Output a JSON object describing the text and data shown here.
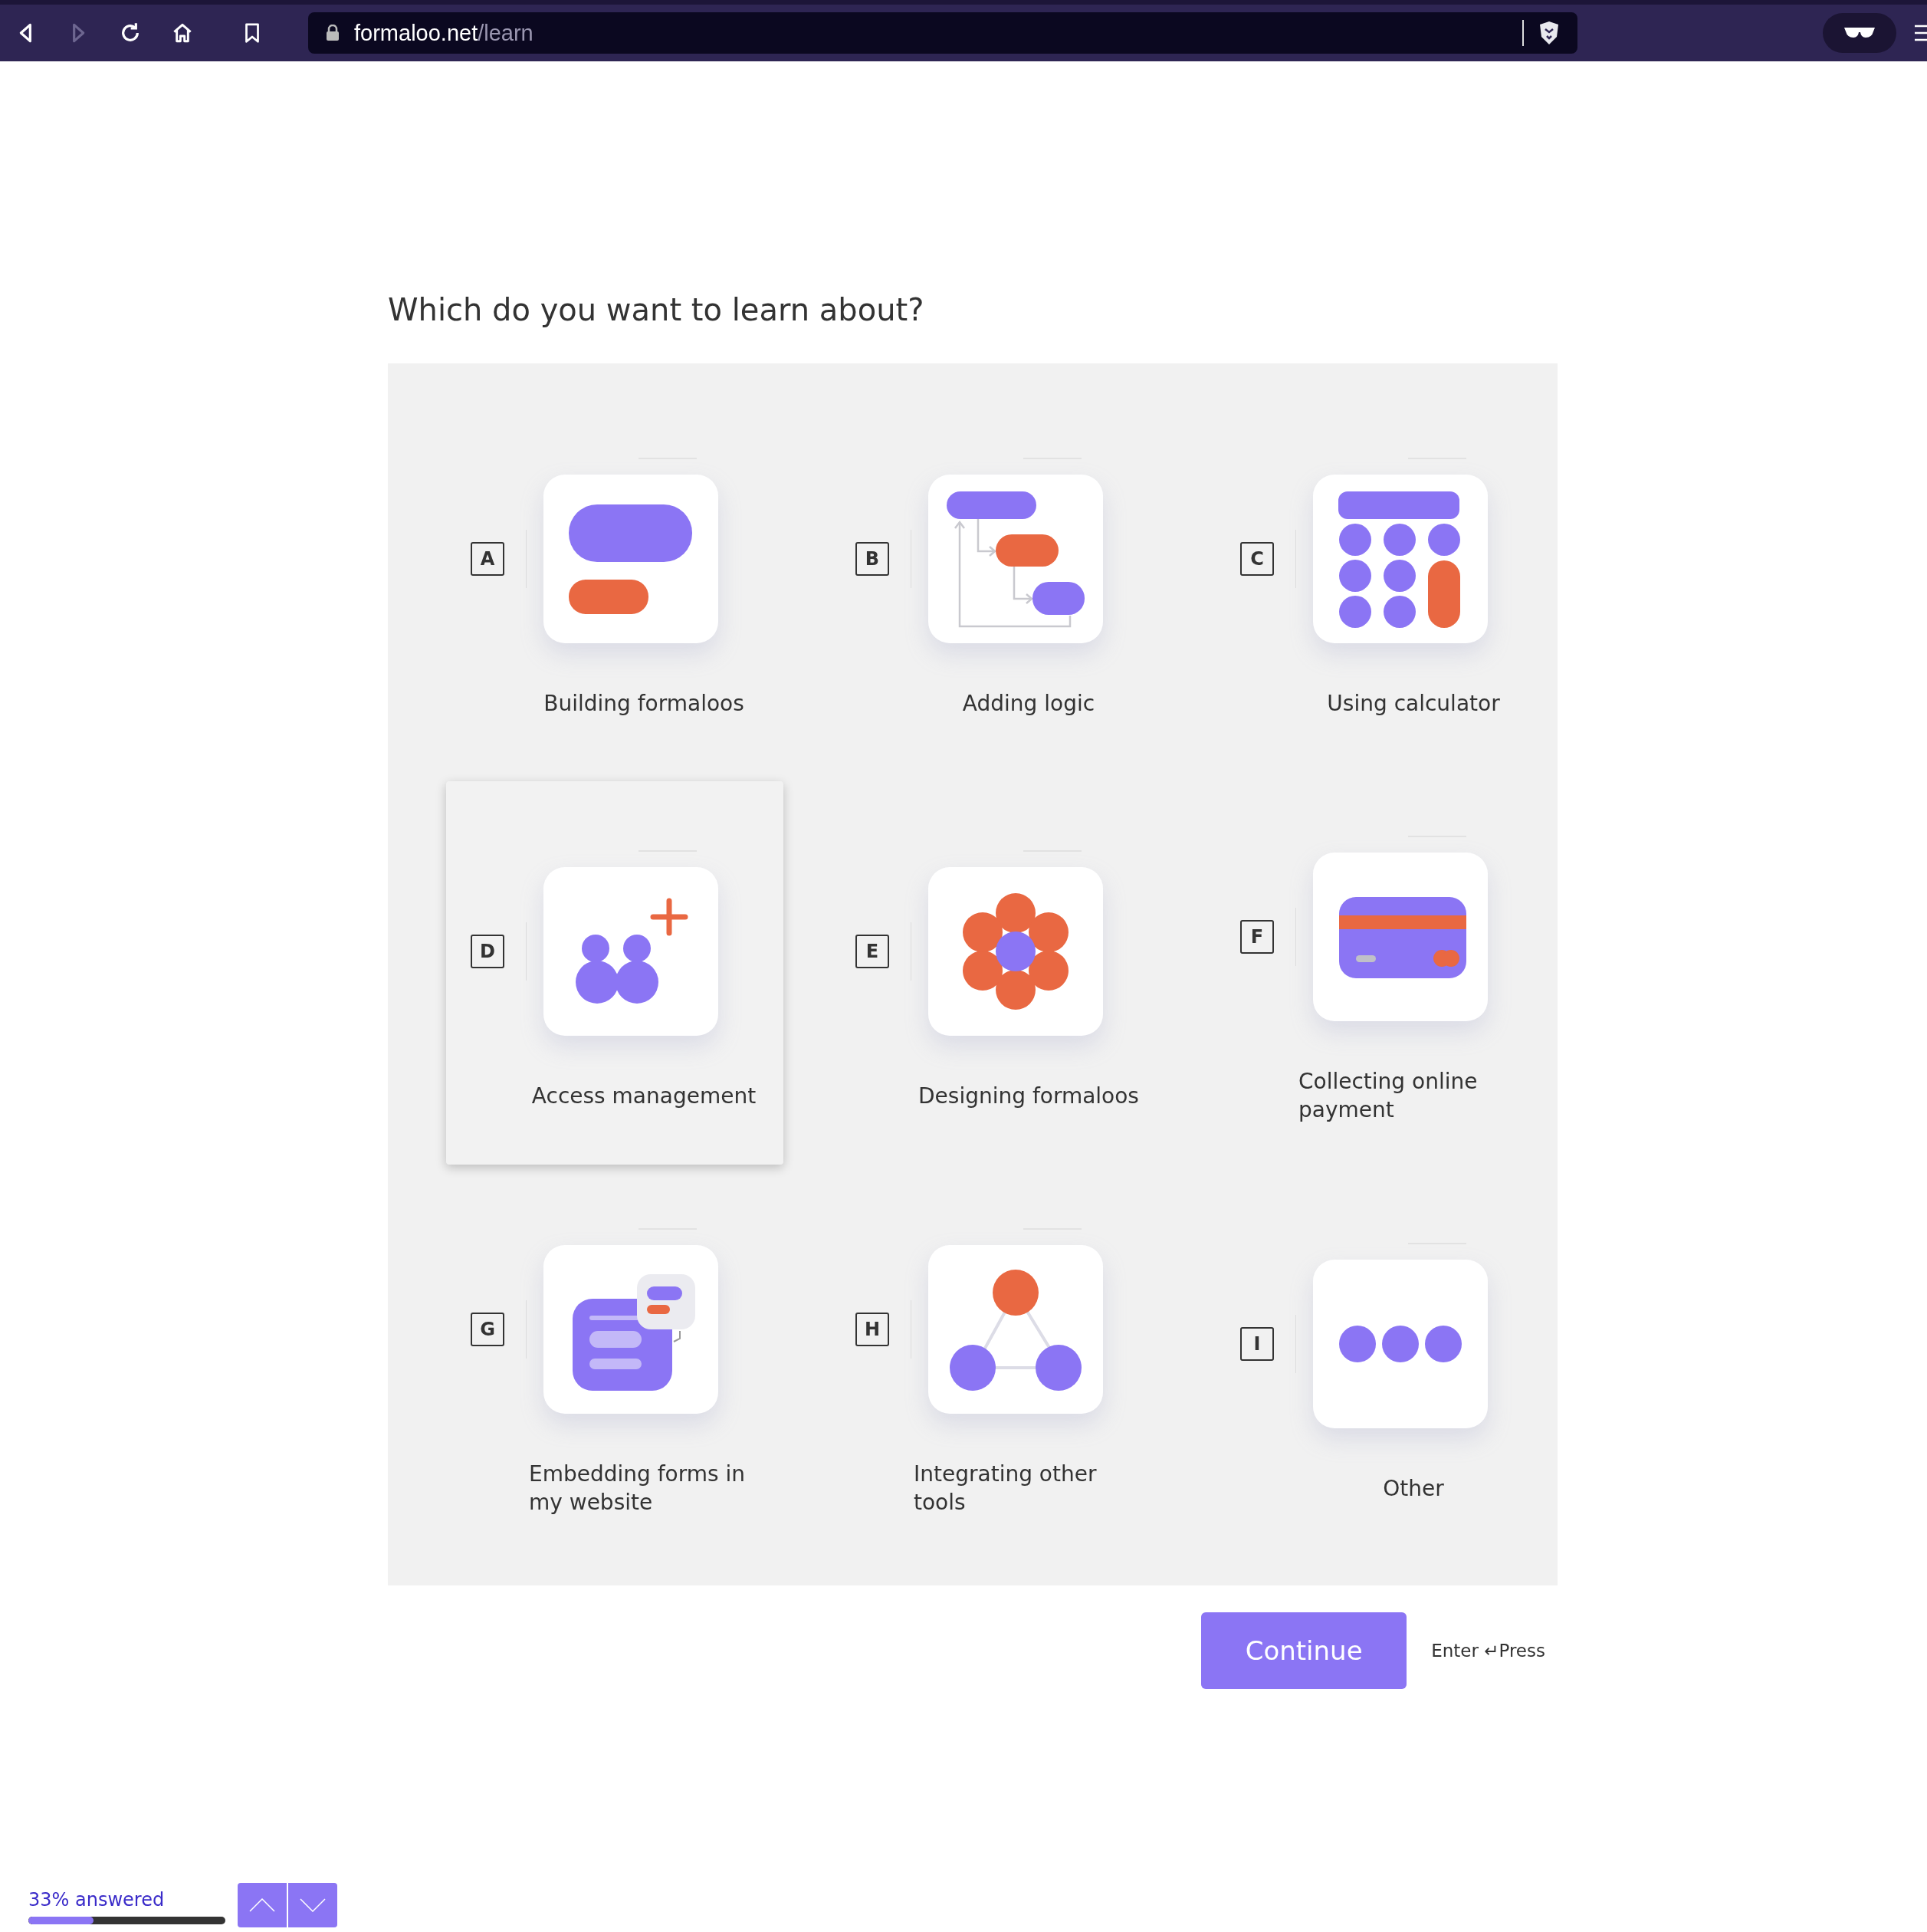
{
  "browser": {
    "host": "formaloo.net",
    "path": "/learn"
  },
  "question": "Which do you want to learn about?",
  "options": [
    {
      "key": "A",
      "label": "Building formaloos",
      "kind": "blocks",
      "highlighted": false
    },
    {
      "key": "B",
      "label": "Adding logic",
      "kind": "logic",
      "highlighted": false
    },
    {
      "key": "C",
      "label": "Using calculator",
      "kind": "calculator",
      "highlighted": false
    },
    {
      "key": "D",
      "label": "Access management",
      "kind": "people",
      "highlighted": true
    },
    {
      "key": "E",
      "label": "Designing formaloos",
      "kind": "flower",
      "highlighted": false
    },
    {
      "key": "F",
      "label": "Collecting online payment",
      "kind": "card",
      "highlighted": false
    },
    {
      "key": "G",
      "label": "Embedding forms in my website",
      "kind": "embed",
      "highlighted": false
    },
    {
      "key": "H",
      "label": "Integrating other tools",
      "kind": "network",
      "highlighted": false
    },
    {
      "key": "I",
      "label": "Other",
      "kind": "dots",
      "highlighted": false
    }
  ],
  "continue_button": "Continue",
  "hint": "Enter ↵Press",
  "progress": {
    "label": "33% answered",
    "level": 0.33
  }
}
